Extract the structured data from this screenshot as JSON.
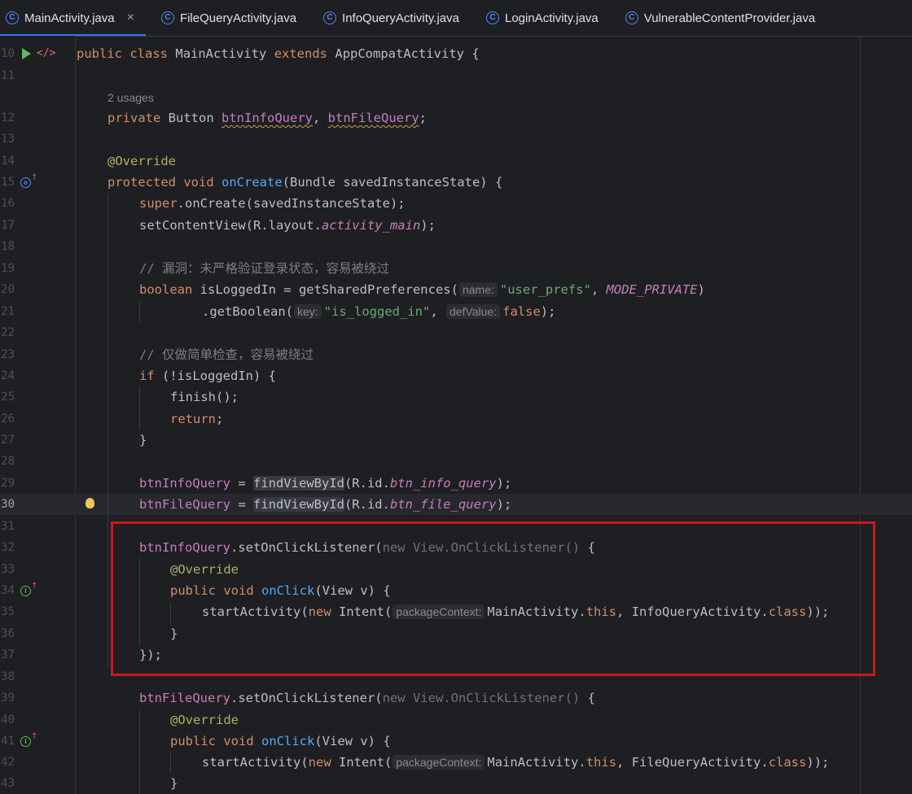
{
  "tabs": [
    {
      "label": "MainActivity.java",
      "active": true,
      "close": "×"
    },
    {
      "label": "FileQueryActivity.java",
      "active": false
    },
    {
      "label": "InfoQueryActivity.java",
      "active": false
    },
    {
      "label": "LoginActivity.java",
      "active": false
    },
    {
      "label": "VulnerableContentProvider.java",
      "active": false
    }
  ],
  "tab_icon_letter": "C",
  "usages_label": "2 usages",
  "line_numbers": [
    "10",
    "11",
    "12",
    "13",
    "14",
    "15",
    "16",
    "17",
    "18",
    "19",
    "20",
    "21",
    "22",
    "23",
    "24",
    "25",
    "26",
    "27",
    "28",
    "29",
    "30",
    "31",
    "32",
    "33",
    "34",
    "35",
    "36",
    "37",
    "38",
    "39",
    "40",
    "41",
    "42",
    "43"
  ],
  "current_line": "30",
  "code": {
    "l10": {
      "a": "public",
      "b": "class",
      "c": "MainActivity",
      "d": "extends",
      "e": "AppCompatActivity {"
    },
    "l12": {
      "a": "private",
      "b": "Button",
      "c": "btnInfoQuery",
      "d": ", ",
      "e": "btnFileQuery",
      "f": ";"
    },
    "l14": {
      "a": "@Override"
    },
    "l15": {
      "a": "protected",
      "b": "void",
      "c": "onCreate",
      "d": "(Bundle savedInstanceState) {"
    },
    "l16": {
      "a": "super",
      "b": ".onCreate(savedInstanceState);"
    },
    "l17": {
      "a": "setContentView(R.layout.",
      "b": "activity_main",
      "c": ");"
    },
    "l19": {
      "a": "// 漏洞：未严格验证登录状态，容易被绕过"
    },
    "l20": {
      "a": "boolean",
      "b": " isLoggedIn = getSharedPreferences(",
      "hint": "name:",
      "c": "\"user_prefs\"",
      "d": ", ",
      "e": "MODE_PRIVATE",
      "f": ")"
    },
    "l21": {
      "a": ".getBoolean(",
      "hint1": "key:",
      "b": "\"is_logged_in\"",
      "c": ", ",
      "hint2": "defValue:",
      "d": "false",
      "e": ");"
    },
    "l23": {
      "a": "// 仅做简单检查，容易被绕过"
    },
    "l24": {
      "a": "if",
      "b": " (!isLoggedIn) {"
    },
    "l25": {
      "a": "finish();"
    },
    "l26": {
      "a": "return",
      "b": ";"
    },
    "l27": {
      "a": "}"
    },
    "l29": {
      "a": "btnInfoQuery",
      "b": " = ",
      "c": "findViewById",
      "d": "(R.id.",
      "e": "btn_info_query",
      "f": ");"
    },
    "l30": {
      "a": "btnFileQuery",
      "b": " = ",
      "c": "findViewById",
      "d": "(R.id.",
      "e": "btn_file_query",
      "f": ");"
    },
    "l32": {
      "a": "btnInfoQuery",
      "b": ".setOnClickListener(",
      "c": "new View.OnClickListener()",
      "d": " {"
    },
    "l33": {
      "a": "@Override"
    },
    "l34": {
      "a": "public",
      "b": "void",
      "c": "onClick",
      "d": "(View v) {"
    },
    "l35": {
      "a": "startActivity(",
      "b": "new",
      "c": " Intent(",
      "hint": "packageContext:",
      "d": "MainActivity.",
      "e": "this",
      "f": ", InfoQueryActivity.",
      "g": "class",
      "h": "));"
    },
    "l36": {
      "a": "}"
    },
    "l37": {
      "a": "});"
    },
    "l39": {
      "a": "btnFileQuery",
      "b": ".setOnClickListener(",
      "c": "new View.OnClickListener()",
      "d": " {"
    },
    "l40": {
      "a": "@Override"
    },
    "l41": {
      "a": "public",
      "b": "void",
      "c": "onClick",
      "d": "(View v) {"
    },
    "l42": {
      "a": "startActivity(",
      "b": "new",
      "c": " Intent(",
      "hint": "packageContext:",
      "d": "MainActivity.",
      "e": "this",
      "f": ", FileQueryActivity.",
      "g": "class",
      "h": "));"
    },
    "l43": {
      "a": "}"
    }
  },
  "colors": {
    "background": "#1e1f22",
    "keyword": "#cf8e6d",
    "function": "#56a8f5",
    "field": "#c77dbb",
    "string": "#6aab73",
    "annotation": "#b3ae60",
    "highlight_box": "#c8191e"
  },
  "icons": {
    "run": "run-gutter-icon",
    "code_view": "code-gutter-icon",
    "override_up": "overrides-method-icon",
    "implements_up": "implements-method-icon",
    "intention": "lightbulb-icon"
  }
}
